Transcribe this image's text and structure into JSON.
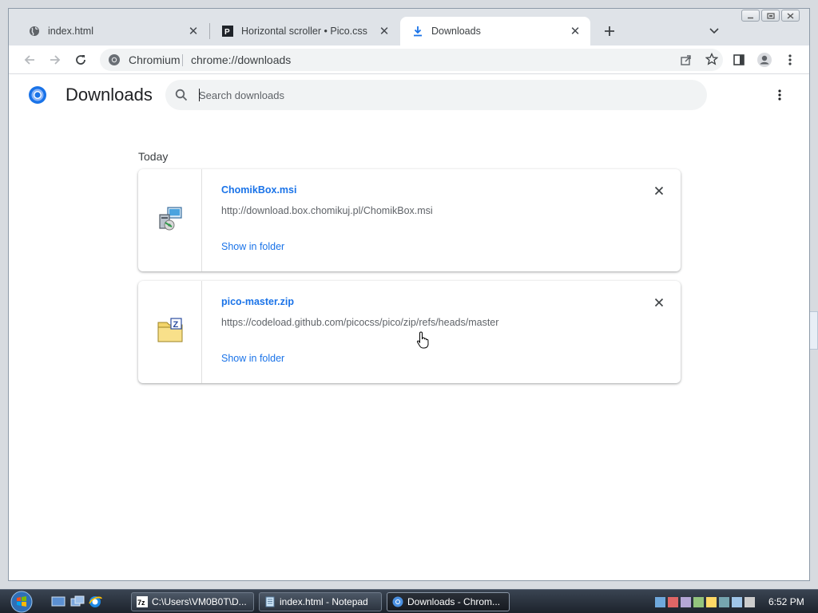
{
  "browser": {
    "tabs": [
      {
        "label": "index.html",
        "icon": "globe-icon",
        "active": false
      },
      {
        "label": "Horizontal scroller • Pico.css",
        "icon": "pico-favicon-icon",
        "active": false
      },
      {
        "label": "Downloads",
        "icon": "download-icon",
        "active": true
      }
    ],
    "omnibox": {
      "site": "Chromium",
      "url": "chrome://downloads"
    }
  },
  "downloads_page": {
    "title": "Downloads",
    "search_placeholder": "Search downloads",
    "date_heading": "Today",
    "items": [
      {
        "file_name": "ChomikBox.msi",
        "source_url": "http://download.box.chomikuj.pl/ChomikBox.msi",
        "action_label": "Show in folder",
        "icon": "msi-installer-icon"
      },
      {
        "file_name": "pico-master.zip",
        "source_url": "https://codeload.github.com/picocss/pico/zip/refs/heads/master",
        "action_label": "Show in folder",
        "icon": "zip-archive-icon"
      }
    ]
  },
  "taskbar": {
    "tasks": [
      {
        "label": "C:\\Users\\VM0B0T\\D...",
        "icon": "7zip-icon"
      },
      {
        "label": "index.html - Notepad",
        "icon": "notepad-icon"
      },
      {
        "label": "Downloads - Chrom...",
        "icon": "chromium-icon"
      }
    ],
    "clock": "6:52 PM"
  },
  "colors": {
    "link": "#1a73e8",
    "tabstrip": "#dfe3e8",
    "taskbar": "#1d232c"
  }
}
